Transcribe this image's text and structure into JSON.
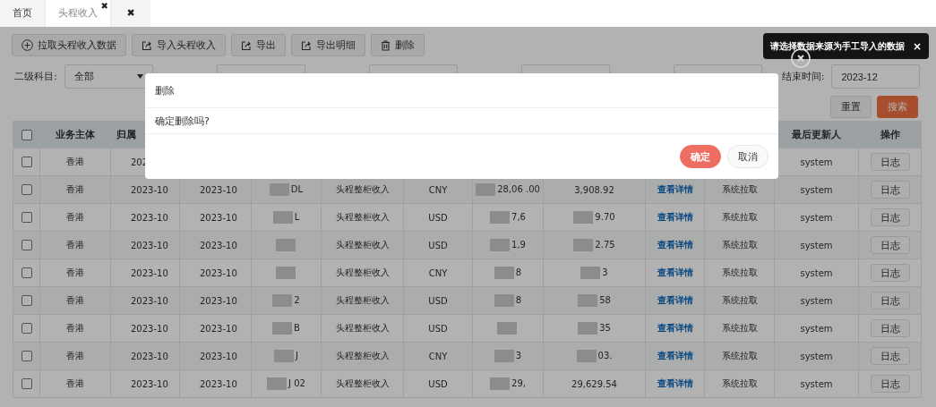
{
  "tabs": [
    {
      "label": "首页",
      "selected": false
    },
    {
      "label": "头程收入",
      "selected": true,
      "close_icon": "✖"
    }
  ],
  "tab_bar_close": "✖",
  "toolbar": [
    {
      "label": "拉取头程收入数据",
      "kind": "plus"
    },
    {
      "label": "导入头程收入",
      "kind": "share"
    },
    {
      "label": "导出",
      "kind": "share"
    },
    {
      "label": "导出明细",
      "kind": "share"
    },
    {
      "label": "删除",
      "kind": "trash"
    }
  ],
  "filters": [
    {
      "kind": "select",
      "label": "二级科目:",
      "value": "全部"
    },
    {
      "kind": "covered"
    },
    {
      "kind": "covered"
    },
    {
      "kind": "covered"
    },
    {
      "kind": "covered"
    },
    {
      "kind": "input",
      "label": "结束时间:",
      "value": "2023-12"
    }
  ],
  "filter_buttons": [
    {
      "label": "重置",
      "kind": "plain"
    },
    {
      "label": "搜索",
      "kind": "primary"
    }
  ],
  "table": {
    "header_checked": false,
    "columns": [
      {
        "kind": "text",
        "label": "业务主体"
      },
      {
        "kind": "text",
        "label": "归属"
      },
      {
        "kind": "covered"
      },
      {
        "kind": "covered"
      },
      {
        "kind": "covered"
      },
      {
        "kind": "covered"
      },
      {
        "kind": "covered"
      },
      {
        "kind": "covered"
      },
      {
        "kind": "covered"
      },
      {
        "kind": "covered"
      },
      {
        "kind": "text",
        "label": "最后更新人"
      },
      {
        "kind": "text",
        "label": "操作"
      }
    ],
    "rows": [
      {
        "checked": false,
        "cells": [
          {
            "kind": "text",
            "text": "香港"
          },
          {
            "kind": "text",
            "text": "202"
          },
          {
            "kind": "covered"
          },
          {
            "kind": "covered"
          },
          {
            "kind": "covered"
          },
          {
            "kind": "covered"
          },
          {
            "kind": "covered"
          },
          {
            "kind": "covered"
          },
          {
            "kind": "covered"
          },
          {
            "kind": "covered"
          },
          {
            "kind": "text",
            "text": "system"
          },
          {
            "kind": "button",
            "text": "日志"
          }
        ]
      },
      {
        "checked": false,
        "cells": [
          {
            "kind": "text",
            "text": "香港"
          },
          {
            "kind": "text",
            "text": "2023-10"
          },
          {
            "kind": "text",
            "text": "2023-10"
          },
          {
            "kind": "text",
            "text": "DL",
            "blurred": true
          },
          {
            "kind": "text",
            "text": "头程整柜收入"
          },
          {
            "kind": "text",
            "text": "CNY"
          },
          {
            "kind": "text",
            "text": "28,06 .00",
            "blurred": true
          },
          {
            "kind": "text",
            "text": "3,908.92"
          },
          {
            "kind": "link",
            "text": "查看详情"
          },
          {
            "kind": "text",
            "text": "系统拉取"
          },
          {
            "kind": "text",
            "text": "system"
          },
          {
            "kind": "button",
            "text": "日志"
          }
        ]
      },
      {
        "checked": false,
        "cells": [
          {
            "kind": "text",
            "text": "香港"
          },
          {
            "kind": "text",
            "text": "2023-10"
          },
          {
            "kind": "text",
            "text": "2023-10"
          },
          {
            "kind": "text",
            "text": "L",
            "blurred": true
          },
          {
            "kind": "text",
            "text": "头程整柜收入"
          },
          {
            "kind": "text",
            "text": "USD"
          },
          {
            "kind": "text",
            "text": "7,6",
            "blurred": true
          },
          {
            "kind": "text",
            "text": "9.70",
            "blurred": true
          },
          {
            "kind": "link",
            "text": "查看详情"
          },
          {
            "kind": "text",
            "text": "系统拉取"
          },
          {
            "kind": "text",
            "text": "system"
          },
          {
            "kind": "button",
            "text": "日志"
          }
        ]
      },
      {
        "checked": false,
        "cells": [
          {
            "kind": "text",
            "text": "香港"
          },
          {
            "kind": "text",
            "text": "2023-10"
          },
          {
            "kind": "text",
            "text": "2023-10"
          },
          {
            "kind": "blurred"
          },
          {
            "kind": "text",
            "text": "头程整柜收入"
          },
          {
            "kind": "text",
            "text": "USD"
          },
          {
            "kind": "text",
            "text": "1,9",
            "blurred": true
          },
          {
            "kind": "text",
            "text": "2.75",
            "blurred": true
          },
          {
            "kind": "link",
            "text": "查看详情"
          },
          {
            "kind": "text",
            "text": "系统拉取"
          },
          {
            "kind": "text",
            "text": "system"
          },
          {
            "kind": "button",
            "text": "日志"
          }
        ]
      },
      {
        "checked": false,
        "cells": [
          {
            "kind": "text",
            "text": "香港"
          },
          {
            "kind": "text",
            "text": "2023-10"
          },
          {
            "kind": "text",
            "text": "2023-10"
          },
          {
            "kind": "blurred"
          },
          {
            "kind": "text",
            "text": "头程整柜收入"
          },
          {
            "kind": "text",
            "text": "CNY"
          },
          {
            "kind": "text",
            "text": "8",
            "blurred": true
          },
          {
            "kind": "text",
            "text": "3",
            "blurred": true
          },
          {
            "kind": "link",
            "text": "查看详情"
          },
          {
            "kind": "text",
            "text": "系统拉取"
          },
          {
            "kind": "text",
            "text": "system"
          },
          {
            "kind": "button",
            "text": "日志"
          }
        ]
      },
      {
        "checked": false,
        "cells": [
          {
            "kind": "text",
            "text": "香港"
          },
          {
            "kind": "text",
            "text": "2023-10"
          },
          {
            "kind": "text",
            "text": "2023-10"
          },
          {
            "kind": "text",
            "text": "2",
            "blurred": true
          },
          {
            "kind": "text",
            "text": "头程整柜收入"
          },
          {
            "kind": "text",
            "text": "USD"
          },
          {
            "kind": "text",
            "text": "8",
            "blurred": true
          },
          {
            "kind": "text",
            "text": "58",
            "blurred": true
          },
          {
            "kind": "link",
            "text": "查看详情"
          },
          {
            "kind": "text",
            "text": "系统拉取"
          },
          {
            "kind": "text",
            "text": "system"
          },
          {
            "kind": "button",
            "text": "日志"
          }
        ]
      },
      {
        "checked": false,
        "cells": [
          {
            "kind": "text",
            "text": "香港"
          },
          {
            "kind": "text",
            "text": "2023-10"
          },
          {
            "kind": "text",
            "text": "2023-10"
          },
          {
            "kind": "text",
            "text": "B",
            "blurred": true
          },
          {
            "kind": "text",
            "text": "头程整柜收入"
          },
          {
            "kind": "text",
            "text": "USD"
          },
          {
            "kind": "blurred"
          },
          {
            "kind": "text",
            "text": "35",
            "blurred": true
          },
          {
            "kind": "link",
            "text": "查看详情"
          },
          {
            "kind": "text",
            "text": "系统拉取"
          },
          {
            "kind": "text",
            "text": "system"
          },
          {
            "kind": "button",
            "text": "日志"
          }
        ]
      },
      {
        "checked": false,
        "cells": [
          {
            "kind": "text",
            "text": "香港"
          },
          {
            "kind": "text",
            "text": "2023-10"
          },
          {
            "kind": "text",
            "text": "2023-10"
          },
          {
            "kind": "text",
            "text": "J",
            "blurred": true
          },
          {
            "kind": "text",
            "text": "头程整柜收入"
          },
          {
            "kind": "text",
            "text": "CNY"
          },
          {
            "kind": "text",
            "text": "3",
            "blurred": true
          },
          {
            "kind": "text",
            "text": "03.",
            "blurred": true
          },
          {
            "kind": "link",
            "text": "查看详情"
          },
          {
            "kind": "text",
            "text": "系统拉取"
          },
          {
            "kind": "text",
            "text": "system"
          },
          {
            "kind": "button",
            "text": "日志"
          }
        ]
      },
      {
        "checked": false,
        "cells": [
          {
            "kind": "text",
            "text": "香港"
          },
          {
            "kind": "text",
            "text": "2023-10"
          },
          {
            "kind": "text",
            "text": "2023-10"
          },
          {
            "kind": "text",
            "text": "J 02",
            "blurred": true
          },
          {
            "kind": "text",
            "text": "头程整柜收入"
          },
          {
            "kind": "text",
            "text": "USD"
          },
          {
            "kind": "text",
            "text": "29,",
            "blurred": true
          },
          {
            "kind": "text",
            "text": "29,629.54"
          },
          {
            "kind": "link",
            "text": "查看详情"
          },
          {
            "kind": "text",
            "text": "系统拉取"
          },
          {
            "kind": "text",
            "text": "system"
          },
          {
            "kind": "button",
            "text": "日志"
          }
        ]
      }
    ]
  },
  "dialog": {
    "title": "删除",
    "message": "确定删除吗?",
    "buttons": [
      {
        "label": "确定",
        "kind": "primary"
      },
      {
        "label": "取消",
        "kind": "plain"
      }
    ]
  },
  "toast": {
    "message": "请选择数据来源为手工导入的数据",
    "close": "×"
  }
}
